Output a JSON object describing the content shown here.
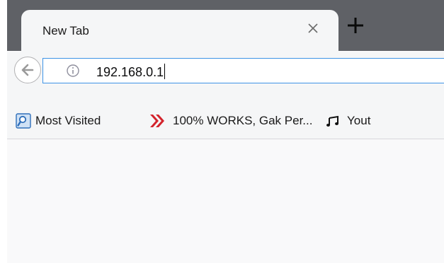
{
  "tab": {
    "title": "New Tab",
    "close_icon": "close-icon",
    "new_tab_icon": "plus-icon"
  },
  "navbar": {
    "back_icon": "back-arrow-icon",
    "info_icon": "info-icon",
    "url": "192.168.0.1"
  },
  "bookmarks": [
    {
      "label": "Most Visited",
      "icon": "most-visited-icon"
    },
    {
      "label": "100% WORKS, Gak Per...",
      "icon": "red-chevrons-icon"
    },
    {
      "label": "Yout",
      "icon": "music-note-icon"
    }
  ],
  "colors": {
    "tabstrip": "#5f6166",
    "toolbar": "#f5f6f7",
    "url_focus_border": "#3d93e6",
    "chevron_red": "#d3232c",
    "most_visited_blue": "#2f6fba"
  }
}
